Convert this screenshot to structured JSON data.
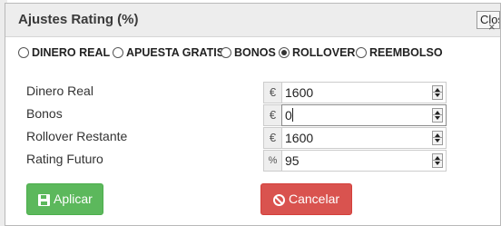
{
  "dialog": {
    "title": "Ajustes Rating (%)",
    "close_label": "Close"
  },
  "mode_options": {
    "selected": "ROLLOVER",
    "items": [
      {
        "label": "DINERO REAL",
        "checked": false
      },
      {
        "label": "APUESTA GRATIS",
        "checked": false
      },
      {
        "label": "BONOS",
        "checked": false
      },
      {
        "label": "ROLLOVER",
        "checked": true
      },
      {
        "label": "REEMBOLSO",
        "checked": false
      }
    ]
  },
  "fields": [
    {
      "label": "Dinero Real",
      "unit": "€",
      "value": "1600"
    },
    {
      "label": "Bonos",
      "unit": "€",
      "value": "0"
    },
    {
      "label": "Rollover Restante",
      "unit": "€",
      "value": "1600"
    },
    {
      "label": "Rating Futuro",
      "unit": "%",
      "value": "95"
    }
  ],
  "actions": {
    "apply_label": "Aplicar",
    "cancel_label": "Cancelar"
  },
  "colors": {
    "apply": "#5cb85c",
    "cancel": "#d9534f",
    "titlebar": "#ededed"
  },
  "icons": {
    "apply": "save-icon",
    "cancel": "ban-icon",
    "close": "close-icon"
  }
}
